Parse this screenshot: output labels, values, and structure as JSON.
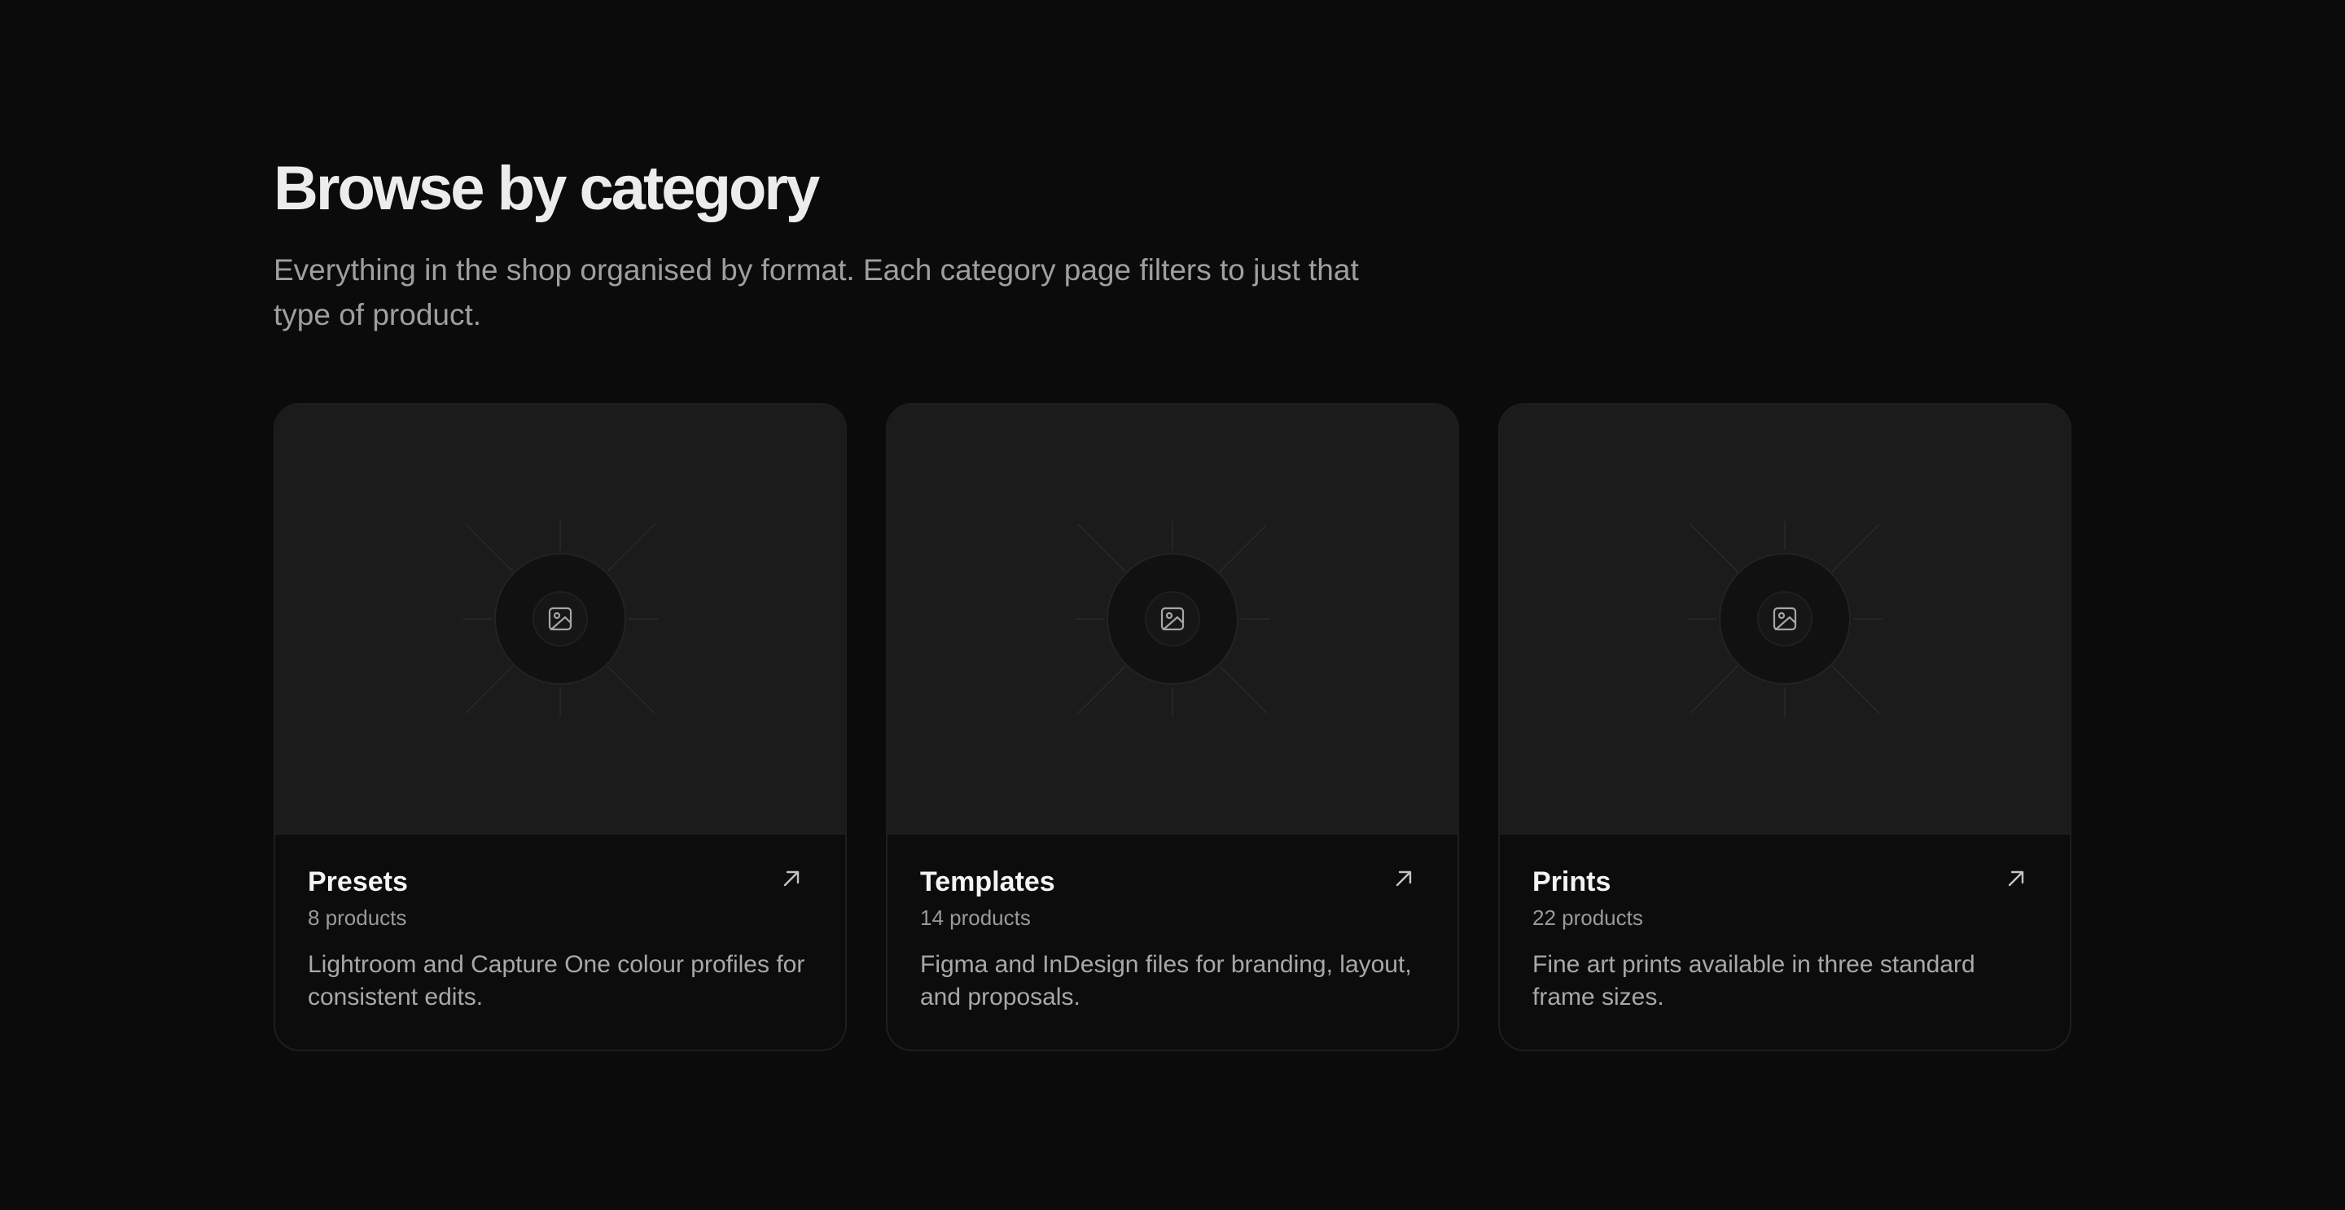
{
  "header": {
    "title": "Browse by category",
    "subtitle": "Everything in the shop organised by format. Each category page filters to just that type of product."
  },
  "categories": [
    {
      "title": "Presets",
      "count": "8 products",
      "description": "Lightroom and Capture One colour profiles for consistent edits.",
      "icon": "image-icon",
      "link_icon": "arrow-up-right-icon"
    },
    {
      "title": "Templates",
      "count": "14 products",
      "description": "Figma and InDesign files for branding, layout, and proposals.",
      "icon": "image-icon",
      "link_icon": "arrow-up-right-icon"
    },
    {
      "title": "Prints",
      "count": "22 products",
      "description": "Fine art prints available in three standard frame sizes.",
      "icon": "image-icon",
      "link_icon": "arrow-up-right-icon"
    }
  ],
  "colors": {
    "background": "#0b0b0b",
    "card_media": "#1b1b1b",
    "card_body": "#0c0c0c",
    "title_text": "#ececec",
    "muted_text": "#9f9f9f"
  }
}
